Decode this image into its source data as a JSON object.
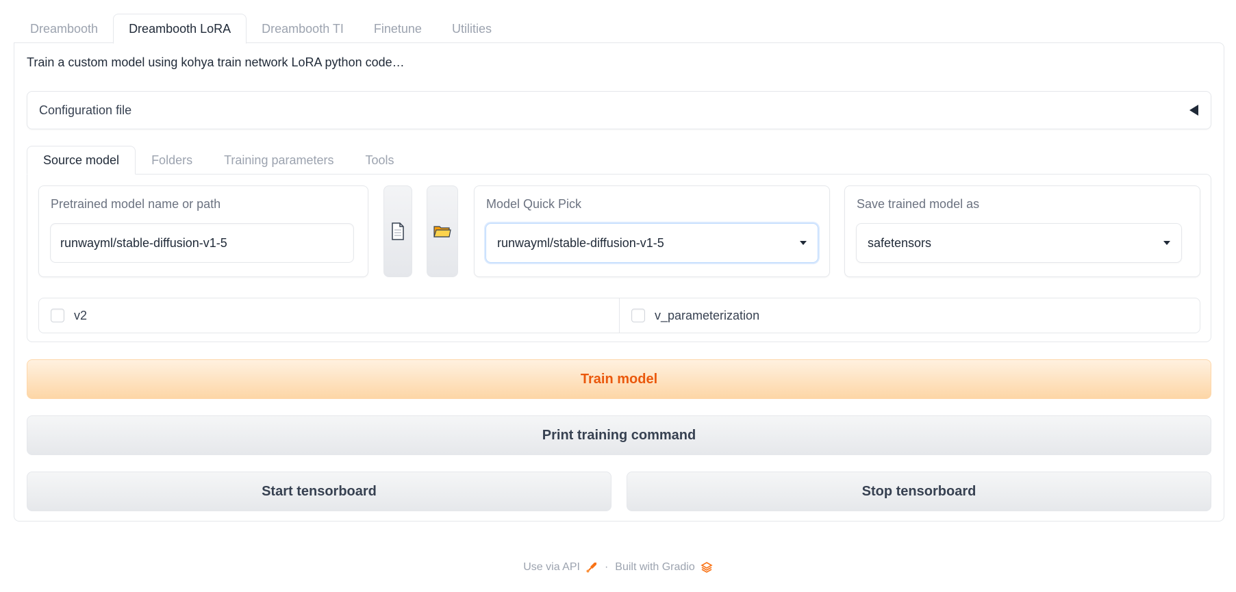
{
  "top_tabs": [
    {
      "label": "Dreambooth",
      "active": false
    },
    {
      "label": "Dreambooth LoRA",
      "active": true
    },
    {
      "label": "Dreambooth TI",
      "active": false
    },
    {
      "label": "Finetune",
      "active": false
    },
    {
      "label": "Utilities",
      "active": false
    }
  ],
  "description": "Train a custom model using kohya train network LoRA python code…",
  "config_accordion": {
    "label": "Configuration file",
    "icon": "triangle-left-icon"
  },
  "inner_tabs": [
    {
      "label": "Source model",
      "active": true
    },
    {
      "label": "Folders",
      "active": false
    },
    {
      "label": "Training parameters",
      "active": false
    },
    {
      "label": "Tools",
      "active": false
    }
  ],
  "source_model": {
    "pretrained": {
      "label": "Pretrained model name or path",
      "value": "runwayml/stable-diffusion-v1-5"
    },
    "file_button_icon": "document-icon",
    "folder_button_icon": "folder-icon",
    "quick_pick": {
      "label": "Model Quick Pick",
      "value": "runwayml/stable-diffusion-v1-5"
    },
    "save_as": {
      "label": "Save trained model as",
      "value": "safetensors"
    },
    "checkboxes": [
      {
        "label": "v2",
        "checked": false
      },
      {
        "label": "v_parameterization",
        "checked": false
      }
    ]
  },
  "buttons": {
    "train": "Train model",
    "print": "Print training command",
    "start_tb": "Start tensorboard",
    "stop_tb": "Stop tensorboard"
  },
  "footer": {
    "api_link": "Use via API",
    "separator": "·",
    "built_with": "Built with Gradio"
  },
  "colors": {
    "primary_text": "#ea580c",
    "primary_bg_top": "#fff1e0",
    "primary_bg_bottom": "#fdd6a6",
    "focus_border": "#bfdbfe"
  }
}
